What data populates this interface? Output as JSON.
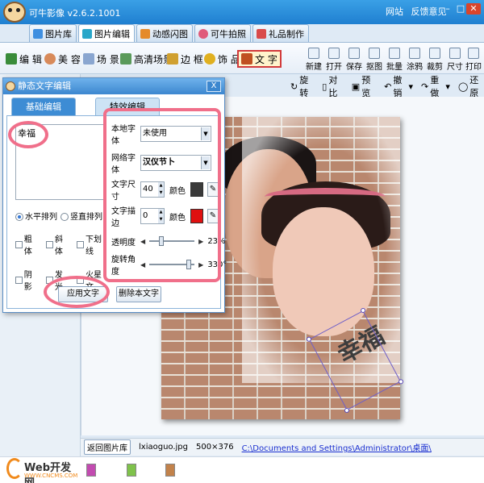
{
  "window": {
    "app_title": "可牛影像 v2.6.2.1001",
    "links": [
      "网站",
      "反馈意见"
    ],
    "buttons": {
      "minimize": "–",
      "maximize": "□",
      "close": "✕"
    }
  },
  "main_tabs": [
    {
      "label": "图片库",
      "icon": "gallery-icon",
      "color": "#3f8fe0"
    },
    {
      "label": "图片编辑",
      "icon": "edit-picture-icon",
      "color": "#2aa7c9"
    },
    {
      "label": "动感闪图",
      "icon": "flash-gif-icon",
      "color": "#e58a2a"
    },
    {
      "label": "可牛拍照",
      "icon": "camera-icon",
      "color": "#e05a7a"
    },
    {
      "label": "礼品制作",
      "icon": "gift-icon",
      "color": "#d94a4a"
    }
  ],
  "tools": [
    {
      "label": "编 辑",
      "icon": "edit-icon",
      "color": "#3a8c3a"
    },
    {
      "label": "美 容",
      "icon": "beauty-icon",
      "color": "#d88a5a"
    },
    {
      "label": "场 景",
      "icon": "scene-icon",
      "color": "#8aa6d0"
    },
    {
      "label": "高清场景",
      "icon": "hd-scene-icon",
      "color": "#5a9a5a"
    },
    {
      "label": "边 框",
      "icon": "frame-icon",
      "color": "#d0a030"
    },
    {
      "label": "饰 品",
      "icon": "decoration-icon",
      "color": "#e0b020"
    },
    {
      "label": "文 字",
      "icon": "text-icon",
      "color": "#c05020"
    }
  ],
  "right_tools": [
    "新建",
    "打开",
    "保存",
    "抠图",
    "批量",
    "涂鸦",
    "裁剪",
    "尺寸",
    "打印"
  ],
  "edit_bar": {
    "rotate": "旋转",
    "compare": "对比",
    "preview": "预览",
    "undo": "撤销",
    "redo": "重做",
    "restore": "还原"
  },
  "dialog": {
    "title": "静态文字编辑",
    "close": "X",
    "tabs": [
      "基础编辑",
      "特效编辑"
    ],
    "text_value": "幸福",
    "orientation": {
      "horizontal": "水平排列",
      "vertical": "竖直排列"
    },
    "checkboxes": [
      "粗体",
      "斜体",
      "下划线",
      "阴影",
      "发光",
      "火星文"
    ],
    "apply_button": "应用文字",
    "delete_button": "删除本文字",
    "local_font_label": "本地字体",
    "local_font_value": "未使用",
    "web_font_label": "网络字体",
    "web_font_value": "汉仪节卜",
    "size_label": "文字尺寸",
    "size_value": "40",
    "color_label": "颜色",
    "size_color": "#3a3a3a",
    "stroke_label": "文字描边",
    "stroke_value": "0",
    "stroke_color": "#e01010",
    "opacity_label": "透明度",
    "opacity_value": "23%",
    "opacity_level": 0.23,
    "rotation_label": "旋转角度",
    "rotation_value": "330°",
    "rotation_level": 0.92
  },
  "canvas": {
    "overlay_text": "幸福"
  },
  "status": {
    "back": "返回图片库",
    "filename": "lxiaoguo.jpg",
    "dims": "500×376",
    "path": "C:\\Documents and Settings\\Administrator\\桌面\\"
  },
  "watermark": {
    "name": "Web开发网",
    "url": "WWW.CNCMS.COM"
  }
}
